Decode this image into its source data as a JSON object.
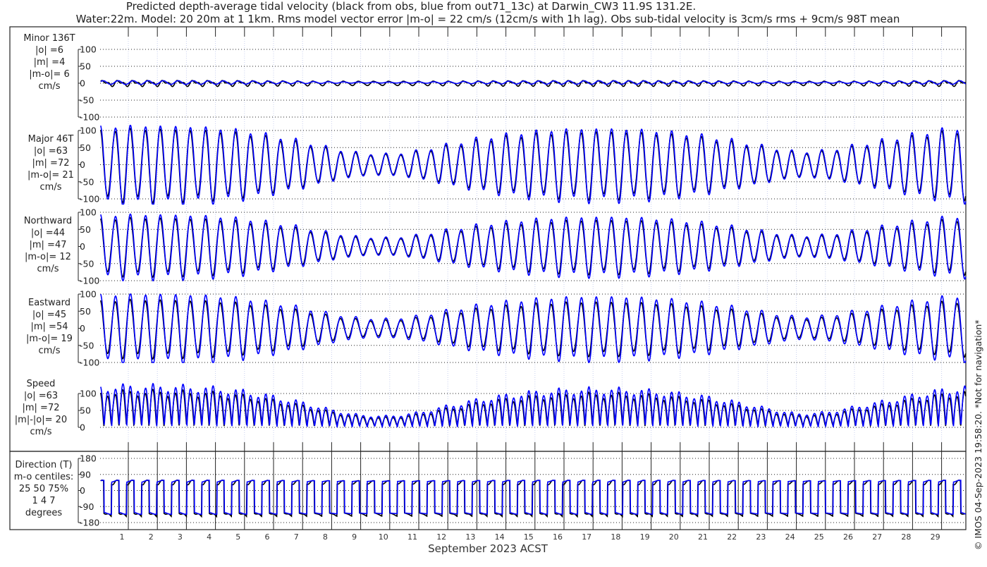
{
  "title_line1": "Predicted depth-average tidal velocity (black from obs, blue from out71_13c) at Darwin_CW3 11.9S 131.2E.",
  "title_line2": "Water:22m. Model: 20 20m at 1 1km. Rms model vector error |m-o| = 22 cm/s (12cm/s with 1h lag). Obs sub-tidal velocity is 3cm/s rms + 9cm/s 98T mean",
  "side_note": "© IMOS 04-Sep-2023 19:58:20. *Not for navigation*",
  "chart_data": {
    "type": "line",
    "xlabel": "September 2023 ACST",
    "x_ticks": [
      "1",
      "2",
      "3",
      "4",
      "5",
      "6",
      "7",
      "8",
      "9",
      "10",
      "11",
      "12",
      "13",
      "14",
      "15",
      "16",
      "17",
      "18",
      "19",
      "20",
      "21",
      "22",
      "23",
      "24",
      "25",
      "26",
      "27",
      "28",
      "29"
    ],
    "x_range_days": [
      0,
      29.8
    ],
    "series_legend": [
      {
        "name": "obs",
        "color": "#000000"
      },
      {
        "name": "model out71_13c",
        "color": "#0000ff"
      }
    ],
    "major_amplitude_envelope_cm_s": [
      108,
      110,
      110,
      108,
      104,
      96,
      82,
      66,
      46,
      32,
      30,
      40,
      58,
      74,
      86,
      95,
      100,
      102,
      101,
      97,
      90,
      80,
      66,
      50,
      36,
      40,
      55,
      70,
      86,
      100,
      106
    ],
    "panels": [
      {
        "id": "minor",
        "label": [
          "Minor 136T",
          "|o| =6",
          "|m| =4",
          "|m-o|= 6",
          "cm/s"
        ],
        "yticks": [
          "100",
          "50",
          "0",
          "-50",
          "-100"
        ],
        "ylim": [
          -100,
          100
        ]
      },
      {
        "id": "major",
        "label": [
          "Major 46T",
          "|o| =63",
          "|m| =72",
          "|m-o|= 21",
          "cm/s"
        ],
        "yticks": [
          "100",
          "50",
          "0",
          "-50",
          "-100"
        ],
        "ylim": [
          -100,
          100
        ]
      },
      {
        "id": "north",
        "label": [
          "Northward",
          "|o| =44",
          "|m| =47",
          "|m-o|= 12",
          "cm/s"
        ],
        "yticks": [
          "100",
          "50",
          "0",
          "-50",
          "-100"
        ],
        "ylim": [
          -100,
          100
        ]
      },
      {
        "id": "east",
        "label": [
          "Eastward",
          "|o| =45",
          "|m| =54",
          "|m-o|= 19",
          "cm/s"
        ],
        "yticks": [
          "100",
          "50",
          "0",
          "-50",
          "-100"
        ],
        "ylim": [
          -100,
          100
        ]
      },
      {
        "id": "speed",
        "label": [
          "Speed",
          "|o| =63",
          "|m| =72",
          "|m|-|o|= 20",
          "cm/s"
        ],
        "yticks": [
          "100",
          "50",
          "0"
        ],
        "ylim": [
          0,
          100
        ]
      },
      {
        "id": "dir",
        "label": [
          "Direction (T)",
          "m-o centiles:",
          "25  50  75%",
          "1  4  7",
          "degrees"
        ],
        "yticks": [
          "180",
          "90",
          "0",
          "-90",
          "-180"
        ],
        "ylim": [
          -180,
          180
        ]
      }
    ]
  }
}
